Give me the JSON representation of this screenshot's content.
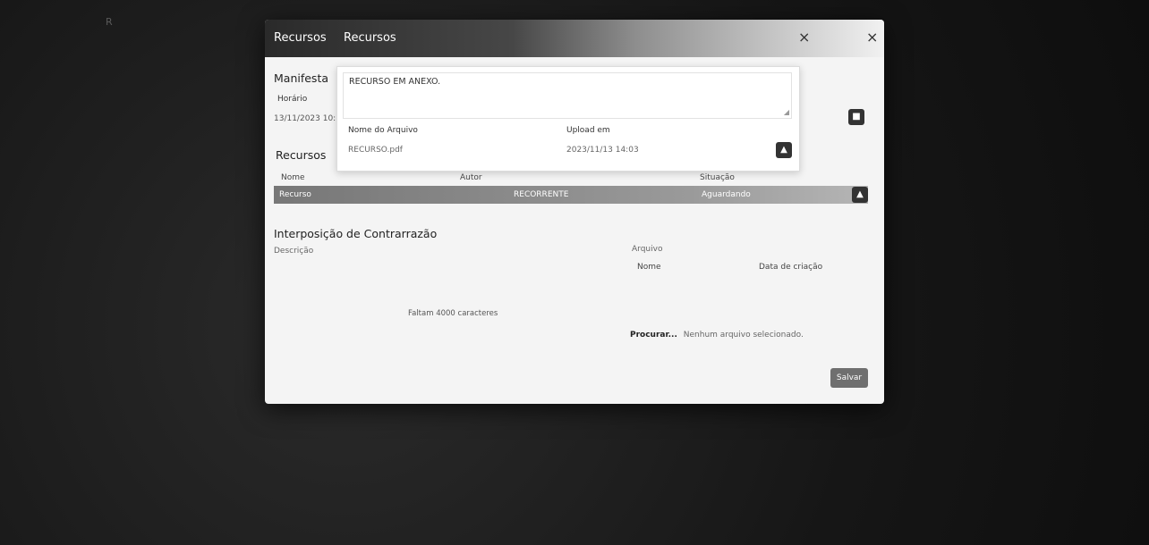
{
  "background": {
    "text_a": "R",
    "text_b": ""
  },
  "modal": {
    "tab1": "Recursos",
    "tab2": "Recursos",
    "close": "×",
    "close2": "×"
  },
  "manifest": {
    "title": "Manifesta",
    "header_label": "Horário",
    "left_date": "13/11/2023 10:"
  },
  "inner_dialog": {
    "text": "RECURSO EM ANEXO.",
    "name_label": "Nome do Arquivo",
    "name_value": "RECURSO.pdf",
    "upload_label": "Upload em",
    "upload_value": "2023/11/13 14:03",
    "upload_icon": "upload-icon"
  },
  "recursos": {
    "title": "Recursos",
    "columns": [
      "Nome",
      "Autor",
      "Situação"
    ],
    "row": {
      "nome": "Recurso",
      "autor": "RECORRENTE",
      "situacao": "Aguardando"
    }
  },
  "contrarrazao": {
    "title": "Interposição de Contrarrazão",
    "description_label": "Descrição",
    "counter": "Faltam 4000 caracteres",
    "arquivo_label": "Arquivo",
    "nome_label": "Nome",
    "data_label": "Data de criação",
    "browse": "Procurar...",
    "no_file": "Nenhum arquivo selecionado.",
    "save": "Salvar"
  },
  "colors": {
    "accent": "#333333",
    "row_selected": "#8a8a8a",
    "save_button": "#6f6f6f"
  }
}
